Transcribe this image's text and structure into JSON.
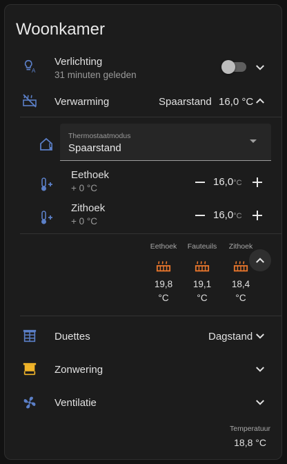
{
  "card": {
    "title": "Woonkamer"
  },
  "verlichting": {
    "label": "Verlichting",
    "sub": "31 minuten geleden",
    "toggle_on": false
  },
  "verwarming": {
    "label": "Verwarming",
    "mode": "Spaarstand",
    "temp": "16,0 °C"
  },
  "thermostat": {
    "label": "Thermostaatmodus",
    "value": "Spaarstand"
  },
  "zones": [
    {
      "name": "Eethoek",
      "sub": "+ 0 °C",
      "value": "16,0",
      "unit": "°C"
    },
    {
      "name": "Zithoek",
      "sub": "+ 0 °C",
      "value": "16,0",
      "unit": "°C"
    }
  ],
  "sensors": [
    {
      "label": "Eethoek",
      "value": "19,8",
      "unit": "°C"
    },
    {
      "label": "Fauteuils",
      "value": "19,1",
      "unit": "°C"
    },
    {
      "label": "Zithoek",
      "value": "18,4",
      "unit": "°C"
    }
  ],
  "duettes": {
    "label": "Duettes",
    "value": "Dagstand"
  },
  "zonwering": {
    "label": "Zonwering"
  },
  "ventilatie": {
    "label": "Ventilatie"
  },
  "footer": {
    "label": "Temperatuur",
    "value": "18,8 °C"
  },
  "colors": {
    "icon_blue": "#5b7fc7",
    "heat_orange": "#e8762c",
    "blind_yellow": "#f0b429"
  },
  "icons": {
    "verlichting": "lightbulb-auto-icon",
    "verwarming": "radiator-off-icon",
    "thermostat": "home-thermometer-icon",
    "zone": "thermometer-plus-icon",
    "sensor": "radiator-icon",
    "duettes": "window-shutter-icon",
    "zonwering": "awning-icon",
    "ventilatie": "fan-icon"
  }
}
